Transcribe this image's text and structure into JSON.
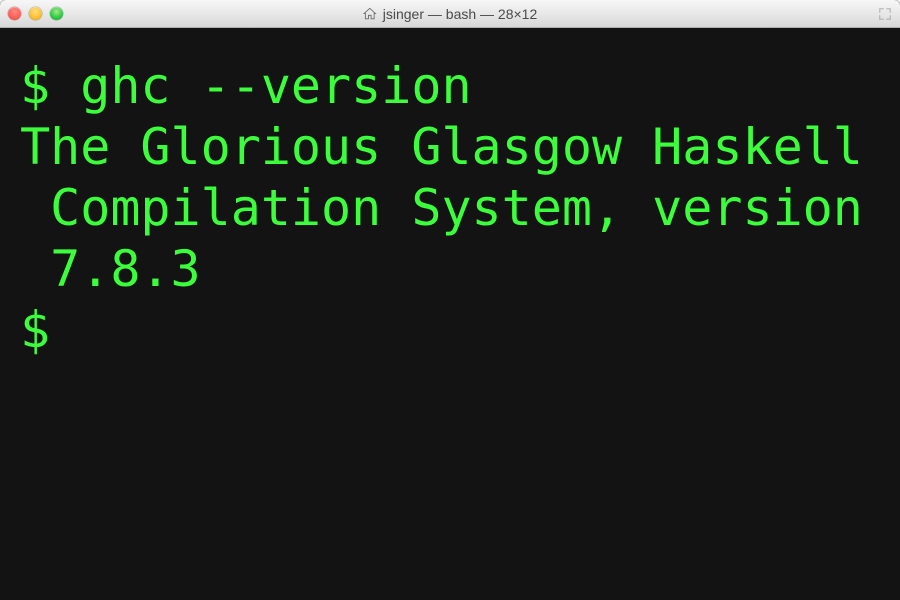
{
  "window": {
    "title": "jsinger — bash — 28×12"
  },
  "terminal": {
    "prompt": "$",
    "lines": [
      {
        "prompt": true,
        "text": "ghc --version"
      },
      {
        "prompt": false,
        "text": "The Glorious Glasgow Haskell"
      },
      {
        "prompt": false,
        "text": " Compilation System, version"
      },
      {
        "prompt": false,
        "text": " 7.8.3"
      },
      {
        "prompt": true,
        "text": ""
      }
    ]
  },
  "colors": {
    "terminal_bg": "#131313",
    "terminal_fg": "#3cff3c"
  }
}
